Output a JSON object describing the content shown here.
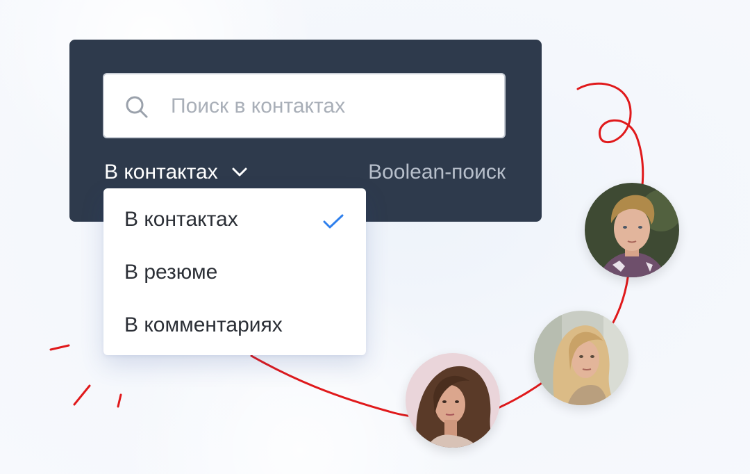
{
  "search": {
    "icon": "search-icon",
    "placeholder": "Поиск в контактах",
    "value": ""
  },
  "scope": {
    "selected": "В контактах",
    "chevron": "chevron-down-icon"
  },
  "boolean_link": "Boolean-поиск",
  "dropdown": {
    "items": [
      {
        "label": "В контактах",
        "selected": true
      },
      {
        "label": "В резюме",
        "selected": false
      },
      {
        "label": "В комментариях",
        "selected": false
      }
    ],
    "check_icon": "check-icon"
  },
  "colors": {
    "panel": "#2e3a4c",
    "accent_check": "#2f80ed",
    "decor_line": "#e0191b",
    "background": "#f2f6fc"
  },
  "avatars": [
    {
      "icon": "person-photo-man"
    },
    {
      "icon": "person-photo-woman-blonde"
    },
    {
      "icon": "person-photo-woman-brunette"
    }
  ]
}
